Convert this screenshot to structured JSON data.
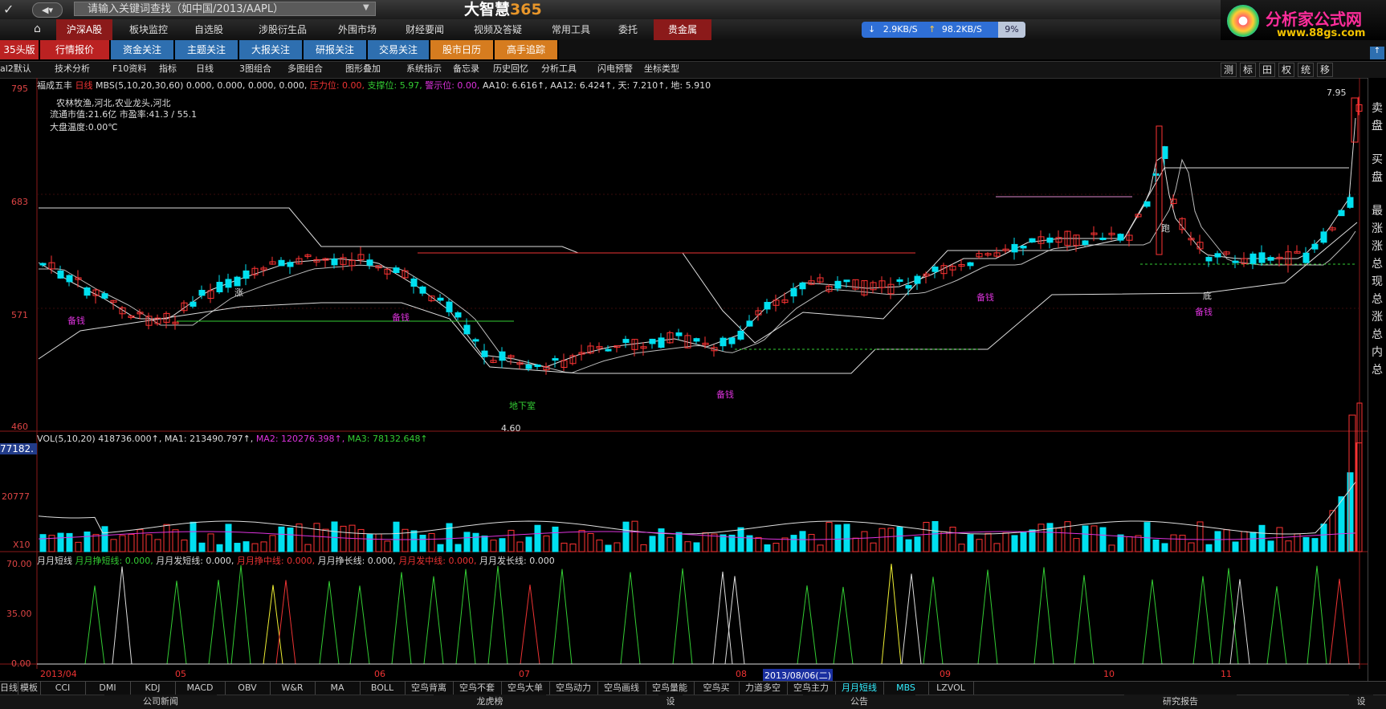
{
  "app": {
    "search_placeholder": "请输入关键词查找（如中国/2013/AAPL）",
    "brand_text": "大智慧",
    "brand_num": "365",
    "logo_text": "分析家公式网",
    "logo_url_text": "www.88gs.com"
  },
  "network": {
    "down": "2.9KB/S",
    "up": "98.2KB/S",
    "pct": "9%"
  },
  "nav": [
    "沪深A股",
    "板块监控",
    "自选股",
    "涉股衍生品",
    "外围市场",
    "财经要闻",
    "视频及答疑",
    "常用工具",
    "委托",
    "贵金属"
  ],
  "tabs2": [
    "35头版",
    "行情报价",
    "资金关注",
    "主题关注",
    "大报关注",
    "研报关注",
    "交易关注",
    "股市日历",
    "高手追踪"
  ],
  "toolbar": [
    "al2默认",
    "技术分析",
    "F10资料",
    "指标",
    "日线",
    "3图组合",
    "多图组合",
    "图形叠加",
    "系统指示",
    "备忘录",
    "历史回忆",
    "分析工具",
    "闪电预警",
    "坐标类型"
  ],
  "toolbar_right": [
    "测",
    "标",
    "田",
    "权",
    "统",
    "移"
  ],
  "main_chart": {
    "header": {
      "stock": "福成五丰",
      "period": "日线",
      "mbs": "MBS(5,10,20,30,60) 0.000, 0.000, 0.000, 0.000,",
      "pressure": "压力位: 0.00,",
      "support": "支撑位: 5.97,",
      "warning": "警示位: 0.00,",
      "aa10": "AA10: 6.616↑,",
      "aa12": "AA12: 6.424↑,",
      "tian": "天: 7.210↑,",
      "di": "地: 5.910"
    },
    "info": [
      "农林牧渔,河北,农业龙头,河北",
      "流通市值:21.6亿   市盈率:41.3 / 55.1",
      "大盘温度:0.00℃"
    ],
    "yticks": [
      "795",
      "683",
      "571",
      "460"
    ],
    "annotations": {
      "price_high": "7.95",
      "price_low": "4.60",
      "beiqian": "备钱",
      "dixiashi": "地下室",
      "pao": "跑",
      "di": "底",
      "zhang": "涨"
    }
  },
  "vol_chart": {
    "header": {
      "name": "VOL(5,10,20)",
      "val": "418736.000↑,",
      "ma1": "MA1: 213490.797↑,",
      "ma2": "MA2: 120276.398↑,",
      "ma3": "MA3: 78132.648↑"
    },
    "yticks": [
      "77182.",
      "20777",
      "X10"
    ]
  },
  "ind_chart": {
    "header": {
      "a": "月月短线",
      "b": "月月挣短线: 0.000,",
      "c": "月月发短线: 0.000,",
      "d": "月月挣中线: 0.000,",
      "e": "月月挣长线: 0.000,",
      "f": "月月发中线: 0.000,",
      "g": "月月发长线: 0.000"
    },
    "yticks": [
      "70.00",
      "35.00",
      "0.00"
    ]
  },
  "dates": {
    "d1": "2013/04",
    "d2": "05",
    "d3": "06",
    "d4": "07",
    "d5": "08",
    "d6": "2013/08/06(二)",
    "d7": "09",
    "d8": "10",
    "d9": "11"
  },
  "bottom_tabs": [
    "日线",
    "模板",
    "CCI",
    "DMI",
    "KDJ",
    "MACD",
    "OBV",
    "W&R",
    "MA",
    "BOLL",
    "空鸟背离",
    "空鸟不套",
    "空鸟大单",
    "空鸟动力",
    "空鸟画线",
    "空鸟量能",
    "空鸟买",
    "力道多空",
    "空鸟主力",
    "月月短线",
    "MBS",
    "LZVOL"
  ],
  "footer_tabs": [
    "公司新闻",
    "龙虎榜",
    "设",
    "公告",
    "研究报告",
    "设"
  ],
  "right_labels": [
    "卖",
    "盘",
    "买",
    "盘",
    "最",
    "涨",
    "涨",
    "总",
    "现",
    "总",
    "涨",
    "总",
    "内",
    "总"
  ],
  "colors": {
    "up": "#ff3333",
    "down": "#00e0f0",
    "bg": "#000000",
    "grid": "#8b1a1a",
    "nav_active": "#8b1a1a",
    "tab_blue": "#2e6fb0",
    "tab_orange": "#d67c1f"
  }
}
